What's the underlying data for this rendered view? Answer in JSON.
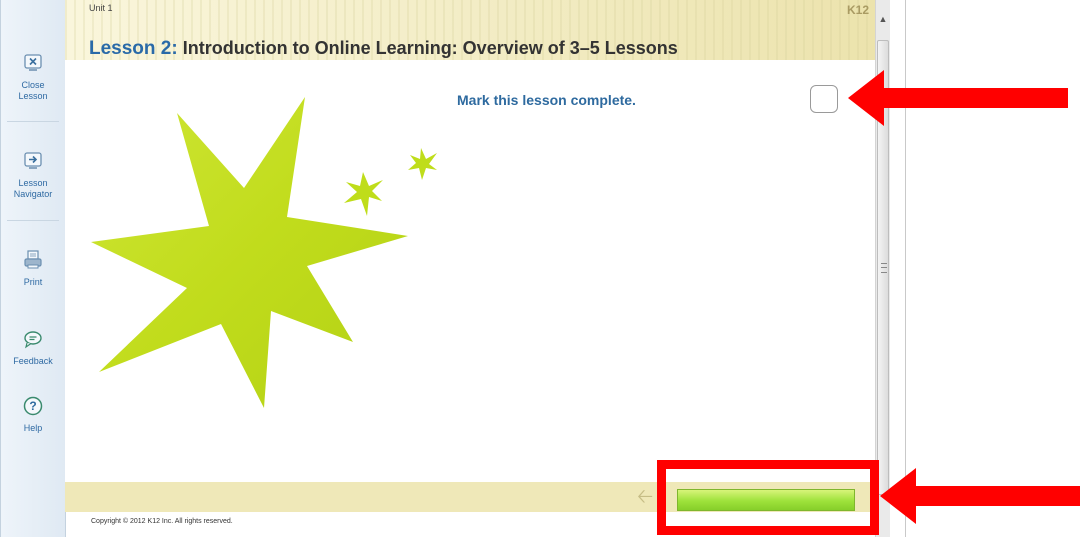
{
  "sidebar": {
    "items": [
      {
        "label_line1": "Close",
        "label_line2": "Lesson",
        "icon": "close-lesson-icon"
      },
      {
        "label_line1": "Lesson",
        "label_line2": "Navigator",
        "icon": "navigator-icon"
      },
      {
        "label_line1": "Print",
        "label_line2": "",
        "icon": "print-icon"
      },
      {
        "label_line1": "Feedback",
        "label_line2": "",
        "icon": "feedback-icon"
      },
      {
        "label_line1": "Help",
        "label_line2": "",
        "icon": "help-icon"
      }
    ]
  },
  "header": {
    "unit": "Unit 1",
    "lesson_number": "Lesson 2:",
    "lesson_title": " Introduction to Online Learning: Overview of 3–5 Lessons",
    "logo": "K12"
  },
  "main": {
    "mark_complete_label": "Mark this lesson complete.",
    "mark_complete_checked": false
  },
  "footer": {
    "copyright": "Copyright © 2012 K12 Inc. All rights reserved.",
    "progress_fraction": 1.0
  },
  "colors": {
    "accent_blue": "#2e6a9f",
    "star_green": "#c3df1e",
    "progress_green": "#9ee23b",
    "annotation_red": "#ff0000"
  }
}
